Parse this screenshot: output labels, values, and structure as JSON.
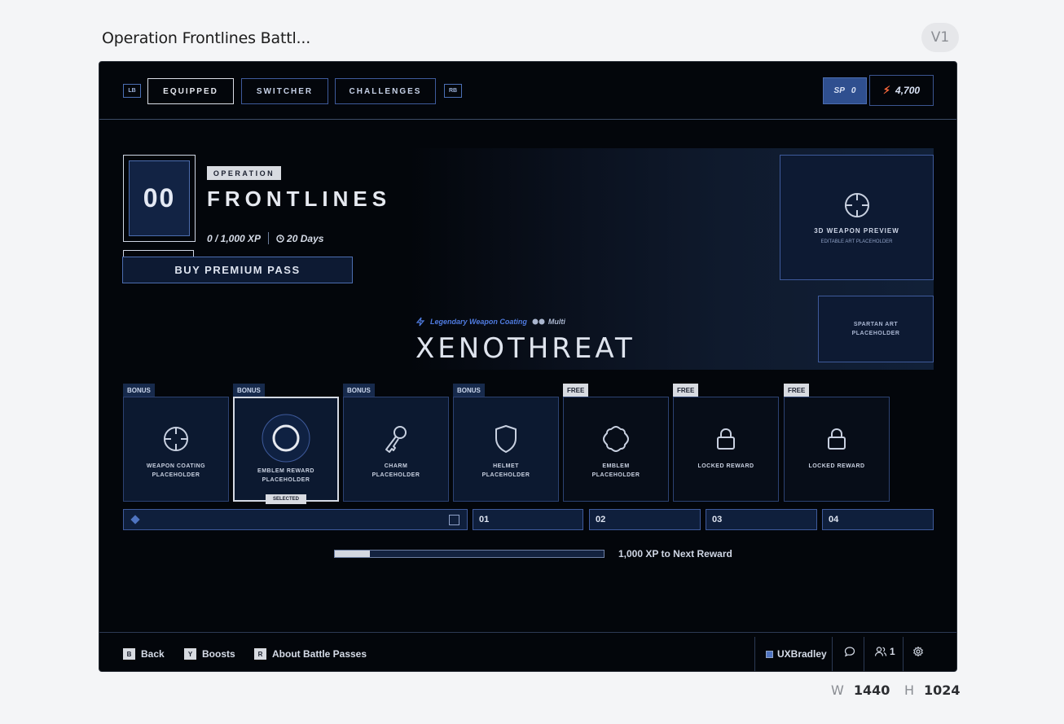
{
  "page": {
    "title": "Operation Frontlines Battl...",
    "version": "V1"
  },
  "canvas": {
    "w_label": "W",
    "w_value": "1440",
    "h_label": "H",
    "h_value": "1024"
  },
  "nav": {
    "lb": "LB",
    "rb": "RB",
    "tabs": [
      {
        "label": "EQUIPPED",
        "active": true
      },
      {
        "label": "SWITCHER",
        "active": false
      },
      {
        "label": "CHALLENGES",
        "active": false
      }
    ],
    "sp_label": "SP",
    "sp_value": "0",
    "credits": "4,700"
  },
  "operation": {
    "level": "00",
    "tag": "OPERATION",
    "name": "FRONTLINES",
    "xp": "0 / 1,000 XP",
    "days": "20 Days",
    "buy_label": "BUY PREMIUM PASS"
  },
  "preview": {
    "weapon_title": "3D WEAPON PREVIEW",
    "weapon_sub": "EDITABLE ART PLACEHOLDER",
    "spartan_line1": "SPARTAN ART",
    "spartan_line2": "PLACEHOLDER"
  },
  "featured": {
    "rarity": "Legendary Weapon Coating",
    "multi": "Multi",
    "name": "XENOTHREAT"
  },
  "rewards": [
    {
      "tag": "BONUS",
      "line1": "WEAPON COATING",
      "line2": "PLACEHOLDER",
      "icon": "crosshair-icon"
    },
    {
      "tag": "BONUS",
      "line1": "EMBLEM REWARD",
      "line2": "PLACEHOLDER",
      "icon": "emblem-ring-icon",
      "selected_label": "SELECTED"
    },
    {
      "tag": "BONUS",
      "line1": "CHARM",
      "line2": "PLACEHOLDER",
      "icon": "charm-key-icon"
    },
    {
      "tag": "BONUS",
      "line1": "HELMET",
      "line2": "PLACEHOLDER",
      "icon": "helmet-shield-icon"
    },
    {
      "tag": "FREE",
      "line1": "EMBLEM",
      "line2": "PLACEHOLDER",
      "icon": "emblem-badge-icon"
    },
    {
      "tag": "FREE",
      "line1": "LOCKED REWARD",
      "line2": "",
      "icon": "lock-icon"
    },
    {
      "tag": "FREE",
      "line1": "LOCKED REWARD",
      "line2": "",
      "icon": "lock-icon"
    }
  ],
  "track": {
    "levels": [
      "01",
      "02",
      "03",
      "04"
    ]
  },
  "progress": {
    "fraction": 0.13,
    "label": "1,000 XP to Next Reward"
  },
  "footer": {
    "back_key": "B",
    "back_label": "Back",
    "boosts_key": "Y",
    "boosts_label": "Boosts",
    "about_key": "R",
    "about_label": "About Battle Passes",
    "gamertag": "UXBradley",
    "party_count": "1"
  },
  "colors": {
    "background": "#03060b",
    "panel": "#0c1930",
    "accent_blue": "#4c6db0",
    "legendary": "#4f7be0",
    "credits_bolt": "#ff6a3d"
  }
}
